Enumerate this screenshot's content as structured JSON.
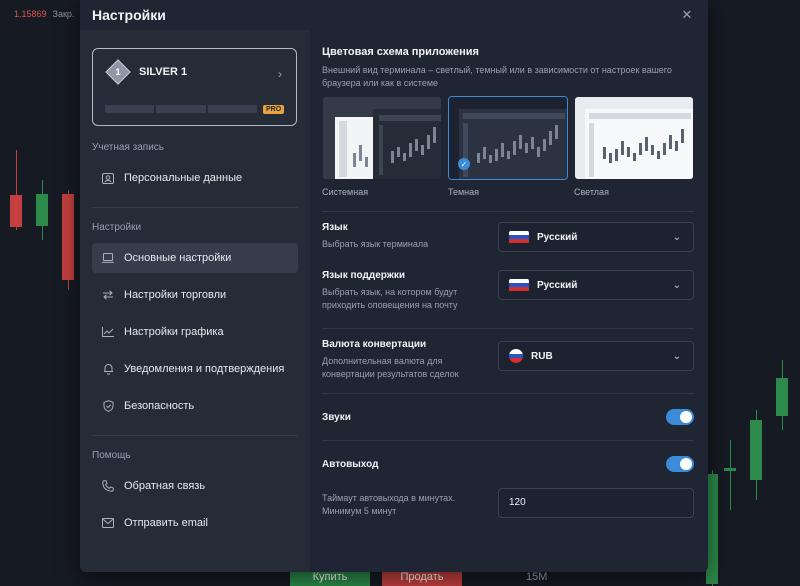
{
  "background": {
    "price": "1.15869",
    "price_label": "Закр.",
    "buy_label": "Купить",
    "sell_label": "Продать",
    "timeframe": "15М"
  },
  "modal": {
    "title": "Настройки",
    "close_icon": "close-icon"
  },
  "sidebar": {
    "status": {
      "level": "1",
      "name": "SILVER 1",
      "badge": "PRO"
    },
    "account_label": "Учетная запись",
    "account_items": [
      {
        "label": "Персональные данные",
        "icon": "id-card-icon"
      }
    ],
    "settings_label": "Настройки",
    "settings_items": [
      {
        "label": "Основные настройки",
        "icon": "laptop-icon",
        "active": true
      },
      {
        "label": "Настройки торговли",
        "icon": "arrows-icon"
      },
      {
        "label": "Настройки графика",
        "icon": "chart-icon"
      },
      {
        "label": "Уведомления и подтверждения",
        "icon": "bell-icon"
      },
      {
        "label": "Безопасность",
        "icon": "shield-icon"
      }
    ],
    "help_label": "Помощь",
    "help_items": [
      {
        "label": "Обратная связь",
        "icon": "phone-icon"
      },
      {
        "label": "Отправить email",
        "icon": "mail-icon"
      }
    ]
  },
  "main": {
    "theme": {
      "title": "Цветовая схема приложения",
      "subtitle": "Внешний вид терминала – светлый, темный или в зависимости от настроек вашего браузера или как в системе",
      "options": [
        {
          "label": "Системная",
          "selected": false
        },
        {
          "label": "Темная",
          "selected": true
        },
        {
          "label": "Светлая",
          "selected": false
        }
      ]
    },
    "language": {
      "title": "Язык",
      "subtitle": "Выбрать язык терминала",
      "value": "Русский"
    },
    "support_language": {
      "title": "Язык поддержки",
      "subtitle": "Выбрать язык, на котором будут приходить оповещения на почту",
      "value": "Русский"
    },
    "currency": {
      "title": "Валюта конвертации",
      "subtitle": "Дополнительная валюта для конвертации результатов сделок",
      "value": "RUB"
    },
    "sounds": {
      "title": "Звуки",
      "enabled": true
    },
    "autologout": {
      "title": "Автовыход",
      "enabled": true
    },
    "timeout": {
      "subtitle": "Таймаут автовыхода в минутах. Минимум 5 минут",
      "value": "120"
    }
  },
  "colors": {
    "accent": "#3b8bd9",
    "modal_bg": "#1f2532",
    "sidebar_bg": "#252b37",
    "pro": "#e8a33c"
  }
}
